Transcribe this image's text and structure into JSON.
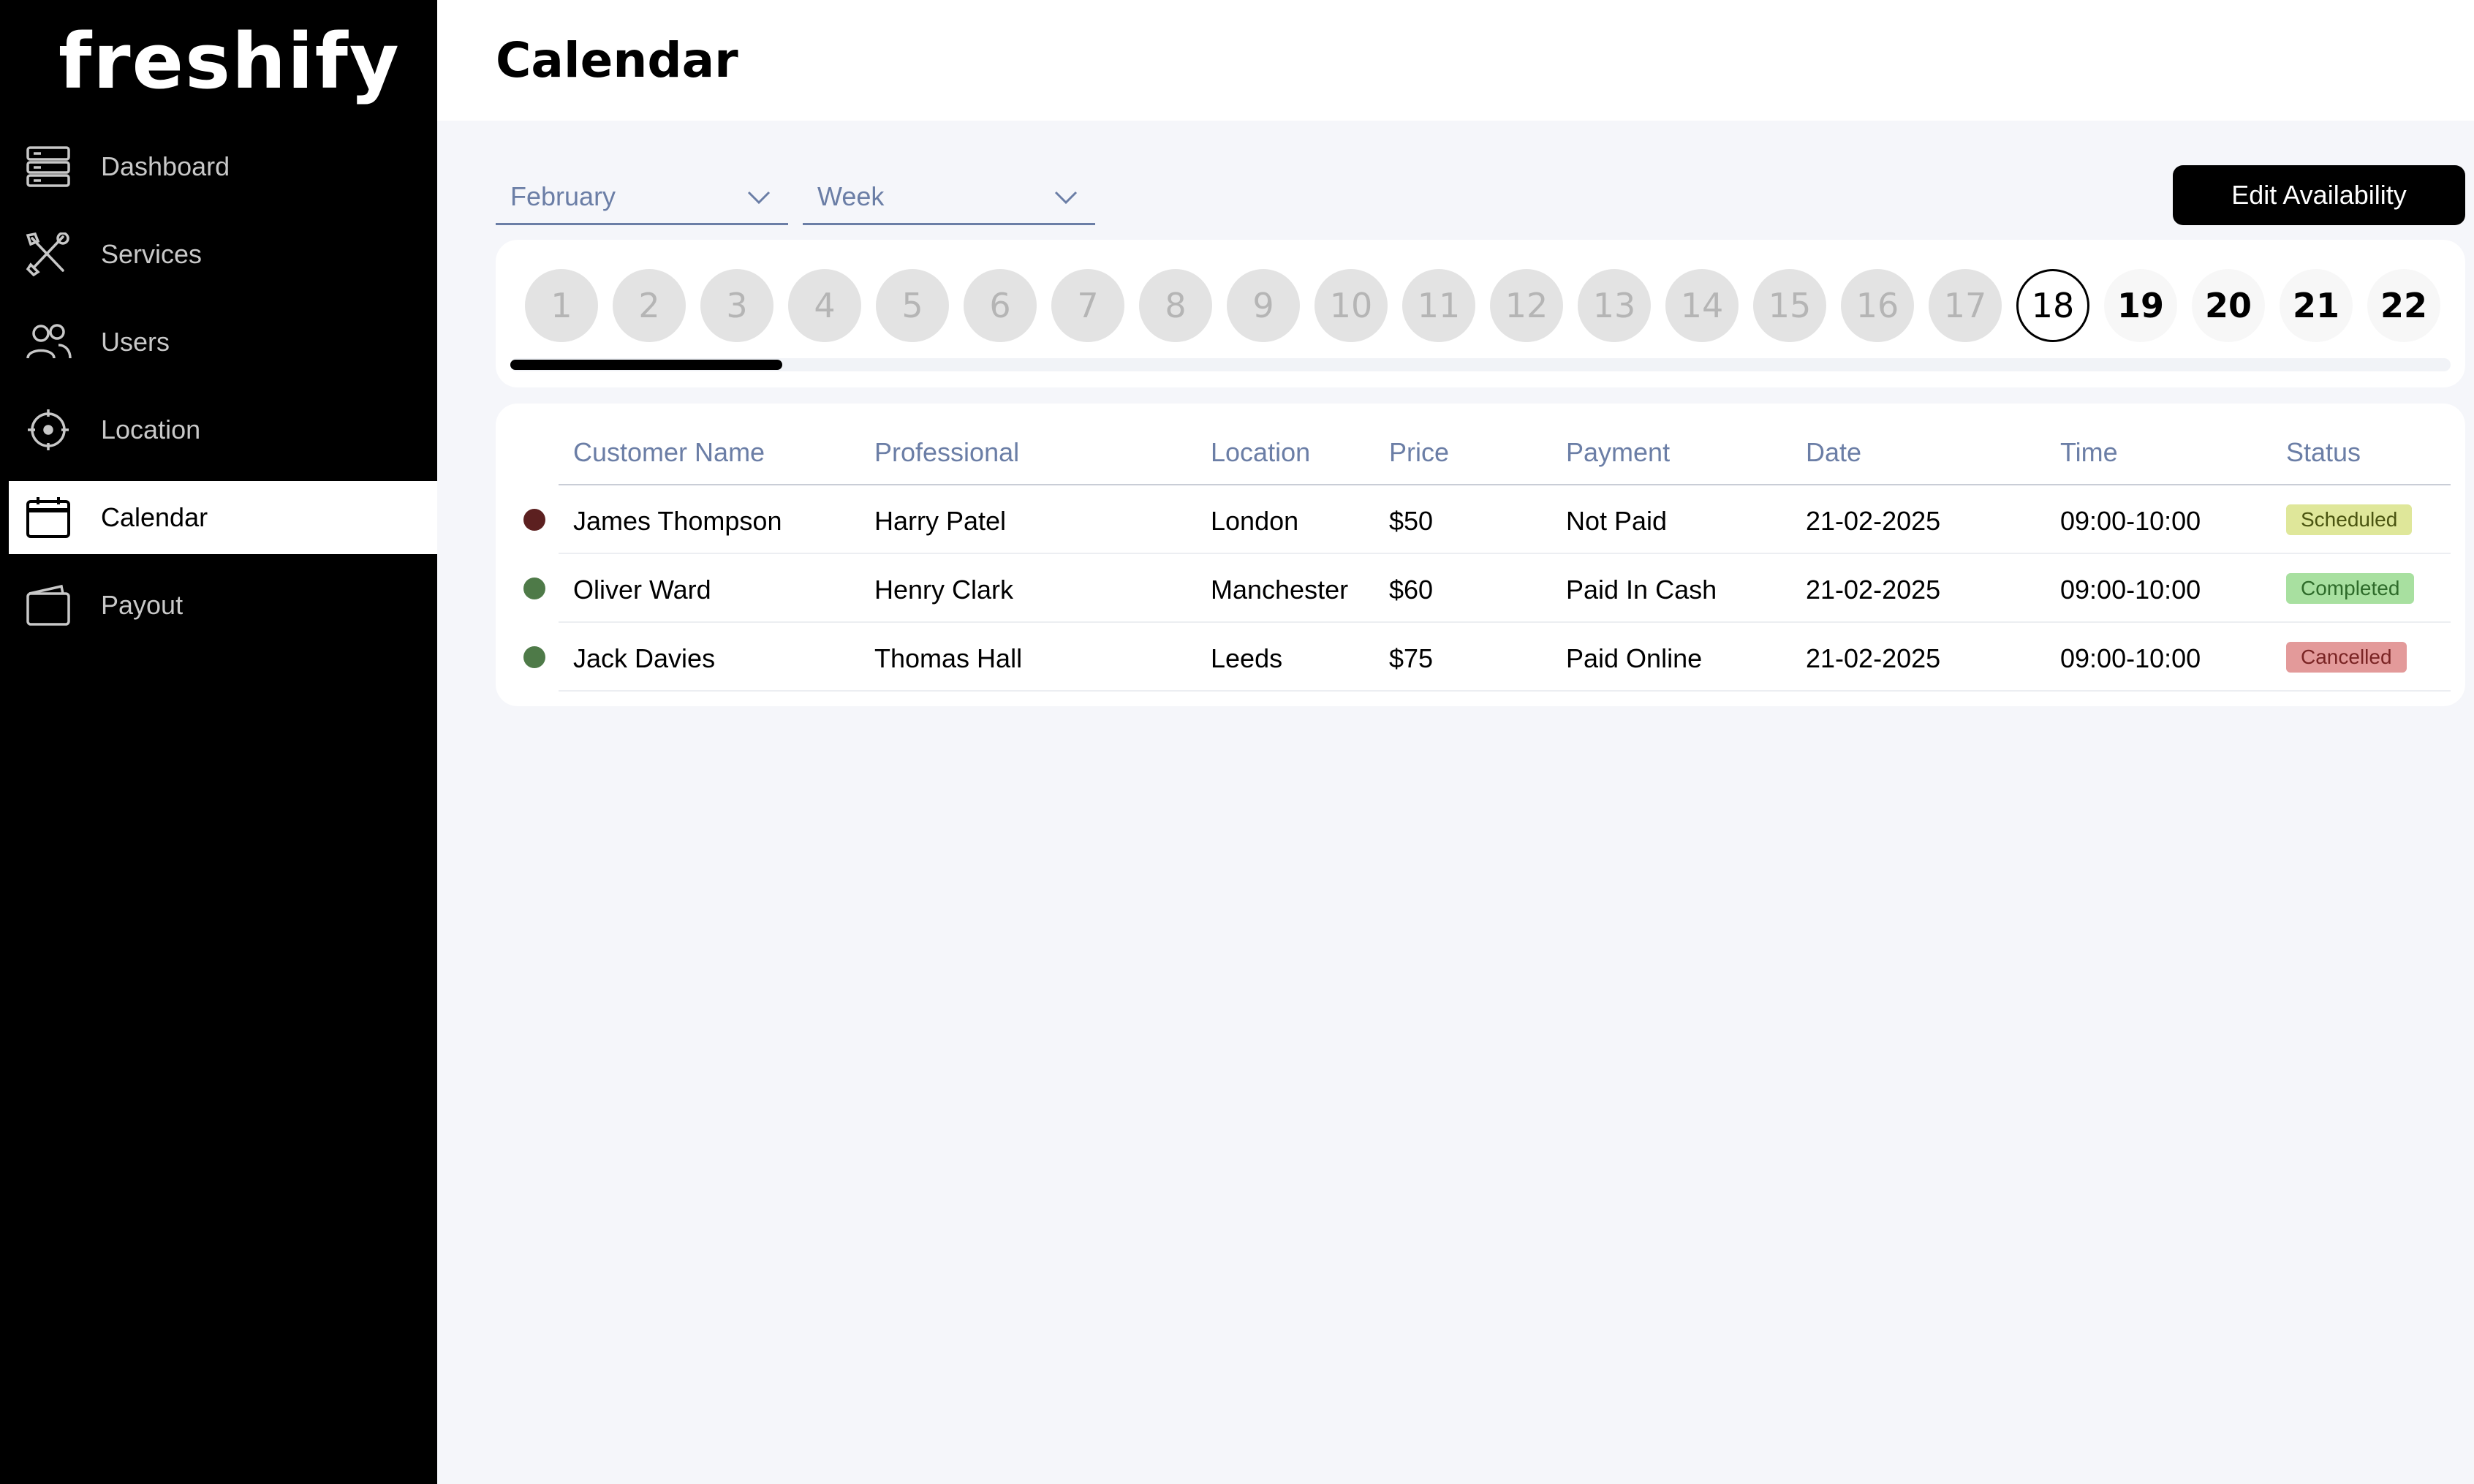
{
  "app": {
    "logo_text": "freshify"
  },
  "sidebar": {
    "items": [
      {
        "label": "Dashboard",
        "icon": "dashboard-icon"
      },
      {
        "label": "Services",
        "icon": "tools-icon"
      },
      {
        "label": "Users",
        "icon": "users-icon"
      },
      {
        "label": "Location",
        "icon": "location-target-icon"
      },
      {
        "label": "Calendar",
        "icon": "calendar-icon",
        "active": true
      },
      {
        "label": "Payout",
        "icon": "wallet-icon"
      }
    ]
  },
  "header": {
    "title": "Calendar"
  },
  "controls": {
    "month_select": "February",
    "view_select": "Week",
    "edit_button": "Edit Availability"
  },
  "days": {
    "items": [
      "1",
      "2",
      "3",
      "4",
      "5",
      "6",
      "7",
      "8",
      "9",
      "10",
      "11",
      "12",
      "13",
      "14",
      "15",
      "16",
      "17",
      "18",
      "19",
      "20",
      "21",
      "22"
    ],
    "selected": "18",
    "scroll_fraction": 0.14
  },
  "table": {
    "headers": {
      "customer": "Customer Name",
      "professional": "Professional",
      "location": "Location",
      "price": "Price",
      "payment": "Payment",
      "date": "Date",
      "time": "Time",
      "status": "Status"
    },
    "rows": [
      {
        "customer": "James Thompson",
        "professional": "Harry Patel",
        "location": "London",
        "price": "$50",
        "payment": "Not Paid",
        "date": "21-02-2025",
        "time": "09:00-10:00",
        "status": "Scheduled",
        "dot_color": "#5c2020",
        "badge_bg": "#dfe79a",
        "badge_fg": "#4a5410"
      },
      {
        "customer": "Oliver Ward",
        "professional": "Henry Clark",
        "location": "Manchester",
        "price": "$60",
        "payment": "Paid In Cash",
        "date": "21-02-2025",
        "time": "09:00-10:00",
        "status": "Completed",
        "dot_color": "#4e7a48",
        "badge_bg": "#a8e0a0",
        "badge_fg": "#2e6b2a"
      },
      {
        "customer": "Jack Davies",
        "professional": "Thomas Hall",
        "location": "Leeds",
        "price": "$75",
        "payment": "Paid Online",
        "date": "21-02-2025",
        "time": "09:00-10:00",
        "status": "Cancelled",
        "dot_color": "#4e7a48",
        "badge_bg": "#e39a9a",
        "badge_fg": "#7a2424"
      }
    ]
  }
}
